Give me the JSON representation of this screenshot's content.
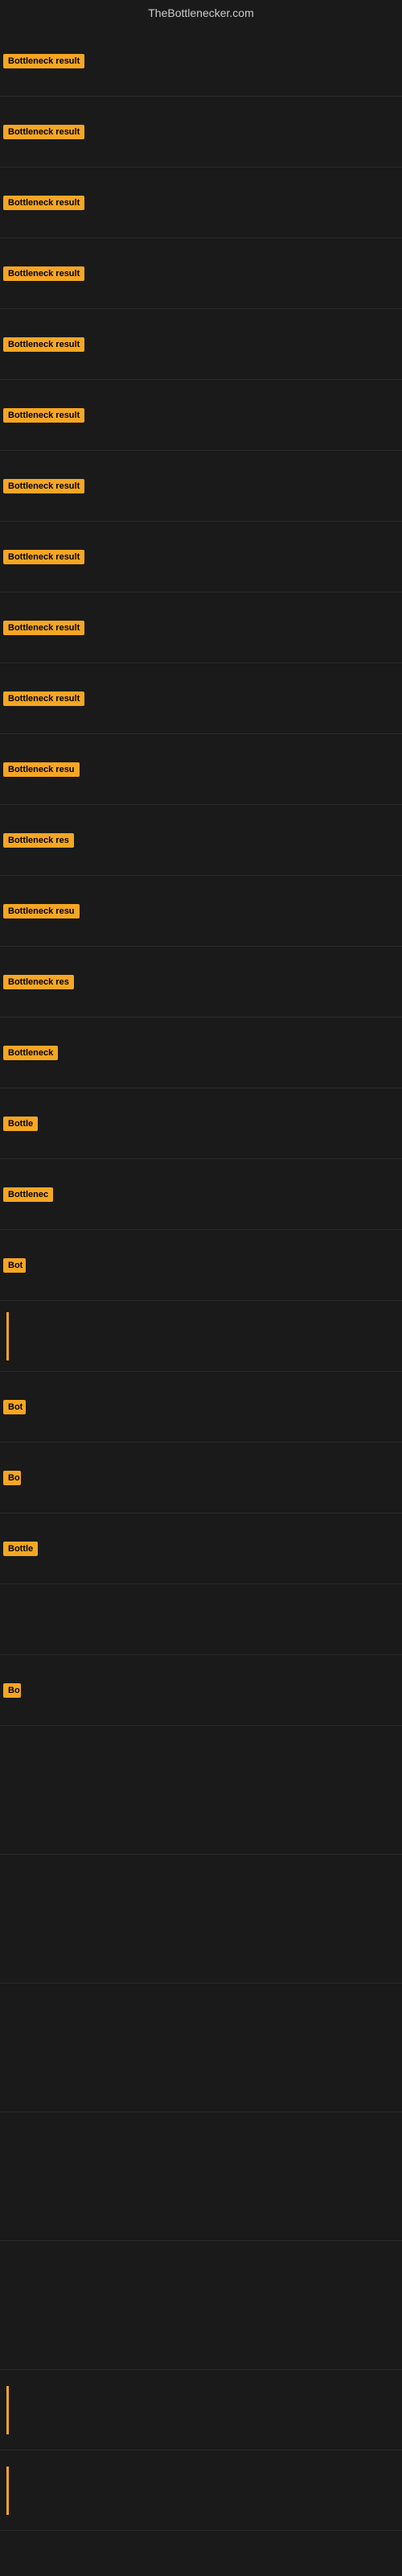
{
  "site": {
    "title": "TheBottlenecker.com"
  },
  "rows": [
    {
      "id": 1,
      "label": "Bottleneck result",
      "truncated": false,
      "height": 88,
      "badgeWidth": 110
    },
    {
      "id": 2,
      "label": "Bottleneck result",
      "truncated": false,
      "height": 88,
      "badgeWidth": 110
    },
    {
      "id": 3,
      "label": "Bottleneck result",
      "truncated": false,
      "height": 88,
      "badgeWidth": 110
    },
    {
      "id": 4,
      "label": "Bottleneck result",
      "truncated": false,
      "height": 88,
      "badgeWidth": 110
    },
    {
      "id": 5,
      "label": "Bottleneck result",
      "truncated": false,
      "height": 88,
      "badgeWidth": 110
    },
    {
      "id": 6,
      "label": "Bottleneck result",
      "truncated": false,
      "height": 88,
      "badgeWidth": 110
    },
    {
      "id": 7,
      "label": "Bottleneck result",
      "truncated": false,
      "height": 88,
      "badgeWidth": 110
    },
    {
      "id": 8,
      "label": "Bottleneck result",
      "truncated": false,
      "height": 88,
      "badgeWidth": 110
    },
    {
      "id": 9,
      "label": "Bottleneck result",
      "truncated": false,
      "height": 88,
      "badgeWidth": 110
    },
    {
      "id": 10,
      "label": "Bottleneck result",
      "truncated": false,
      "height": 88,
      "badgeWidth": 110
    },
    {
      "id": 11,
      "label": "Bottleneck resu",
      "truncated": true,
      "height": 88,
      "badgeWidth": 105
    },
    {
      "id": 12,
      "label": "Bottleneck res",
      "truncated": true,
      "height": 88,
      "badgeWidth": 98
    },
    {
      "id": 13,
      "label": "Bottleneck resu",
      "truncated": true,
      "height": 88,
      "badgeWidth": 105
    },
    {
      "id": 14,
      "label": "Bottleneck res",
      "truncated": true,
      "height": 88,
      "badgeWidth": 98
    },
    {
      "id": 15,
      "label": "Bottleneck",
      "truncated": true,
      "height": 88,
      "badgeWidth": 70
    },
    {
      "id": 16,
      "label": "Bottle",
      "truncated": true,
      "height": 88,
      "badgeWidth": 45
    },
    {
      "id": 17,
      "label": "Bottlenec",
      "truncated": true,
      "height": 88,
      "badgeWidth": 62
    },
    {
      "id": 18,
      "label": "Bot",
      "truncated": true,
      "height": 88,
      "badgeWidth": 28
    },
    {
      "id": 19,
      "label": "",
      "truncated": true,
      "height": 88,
      "badgeWidth": 0,
      "isLine": true
    },
    {
      "id": 20,
      "label": "Bot",
      "truncated": true,
      "height": 88,
      "badgeWidth": 28
    },
    {
      "id": 21,
      "label": "Bo",
      "truncated": true,
      "height": 88,
      "badgeWidth": 22
    },
    {
      "id": 22,
      "label": "Bottle",
      "truncated": true,
      "height": 88,
      "badgeWidth": 45
    },
    {
      "id": 23,
      "label": "",
      "truncated": true,
      "height": 88,
      "badgeWidth": 0
    },
    {
      "id": 24,
      "label": "Bo",
      "truncated": true,
      "height": 88,
      "badgeWidth": 22
    },
    {
      "id": 25,
      "label": "",
      "truncated": true,
      "height": 160,
      "badgeWidth": 0
    },
    {
      "id": 26,
      "label": "",
      "truncated": true,
      "height": 160,
      "badgeWidth": 0
    },
    {
      "id": 27,
      "label": "",
      "truncated": true,
      "height": 160,
      "badgeWidth": 0
    },
    {
      "id": 28,
      "label": "",
      "truncated": true,
      "height": 160,
      "badgeWidth": 0
    },
    {
      "id": 29,
      "label": "",
      "truncated": true,
      "height": 160,
      "badgeWidth": 0
    },
    {
      "id": 30,
      "label": "",
      "truncated": true,
      "height": 100,
      "badgeWidth": 0,
      "isLine": true
    },
    {
      "id": 31,
      "label": "",
      "truncated": true,
      "height": 100,
      "badgeWidth": 0,
      "isLine": true
    }
  ]
}
